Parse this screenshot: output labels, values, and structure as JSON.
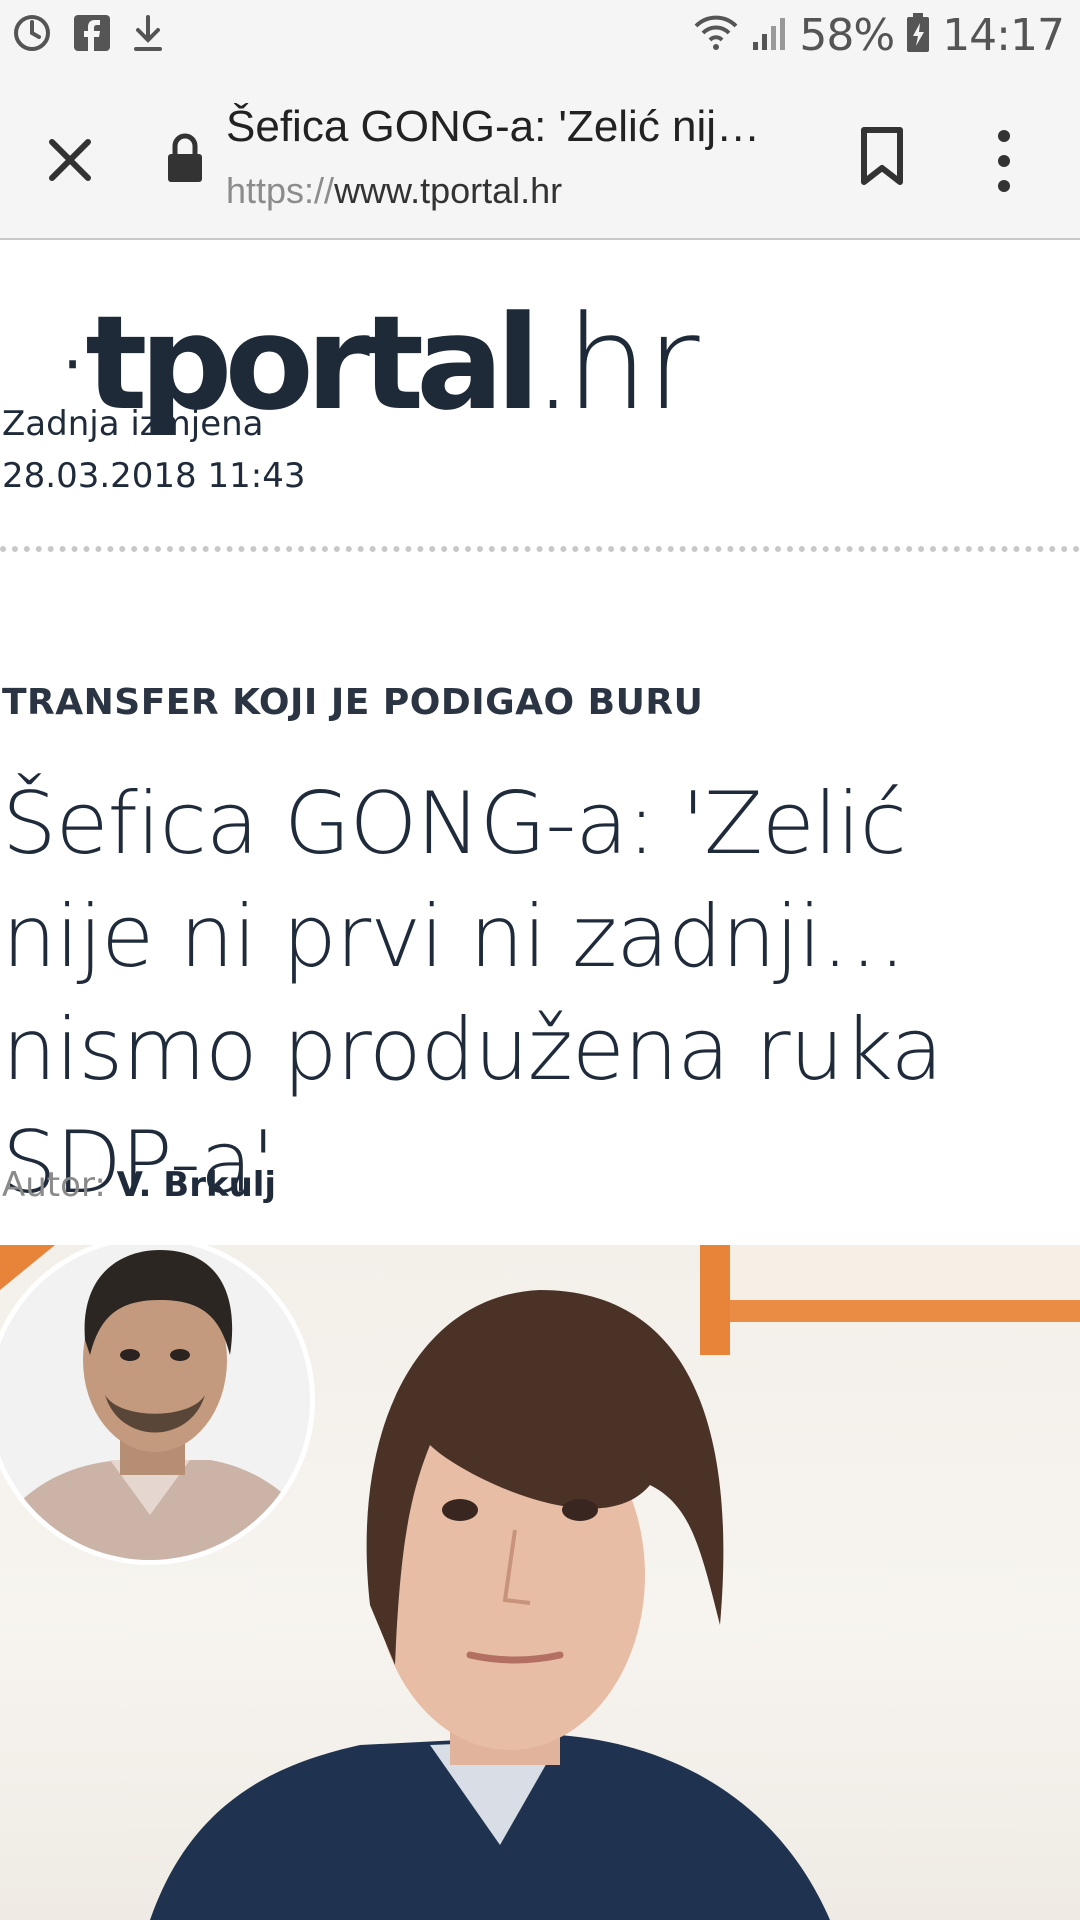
{
  "status_bar": {
    "battery": "58%",
    "time": "14:17",
    "icons": [
      "sync-icon",
      "facebook-icon",
      "download-icon",
      "wifi-icon",
      "signal-icon",
      "battery-charging-icon"
    ]
  },
  "browser": {
    "tab_title": "Šefica GONG-a: 'Zelić nij…",
    "url_scheme": "https://",
    "url_host": "www.tportal.hr",
    "icons": [
      "close-icon",
      "lock-icon",
      "bookmark-icon",
      "more-vert-icon"
    ]
  },
  "site": {
    "logo_dot": "·",
    "logo_brand": "tportal",
    "logo_tld": "hr"
  },
  "article": {
    "last_change": "Zadnja izmjena 28.03.2018 11:43",
    "kicker": "TRANSFER KOJI JE PODIGAO BURU",
    "headline": "Šefica GONG-a: 'Zelić nije ni prvi ni zadnji… nismo produžena ruka SDP-a'",
    "author_label": "Autor:",
    "author_name": "V. Brkulj"
  },
  "colors": {
    "accent_orange": "#e8843a",
    "text_dark": "#1f2b3a",
    "toolbar_bg": "#f5f5f5"
  }
}
